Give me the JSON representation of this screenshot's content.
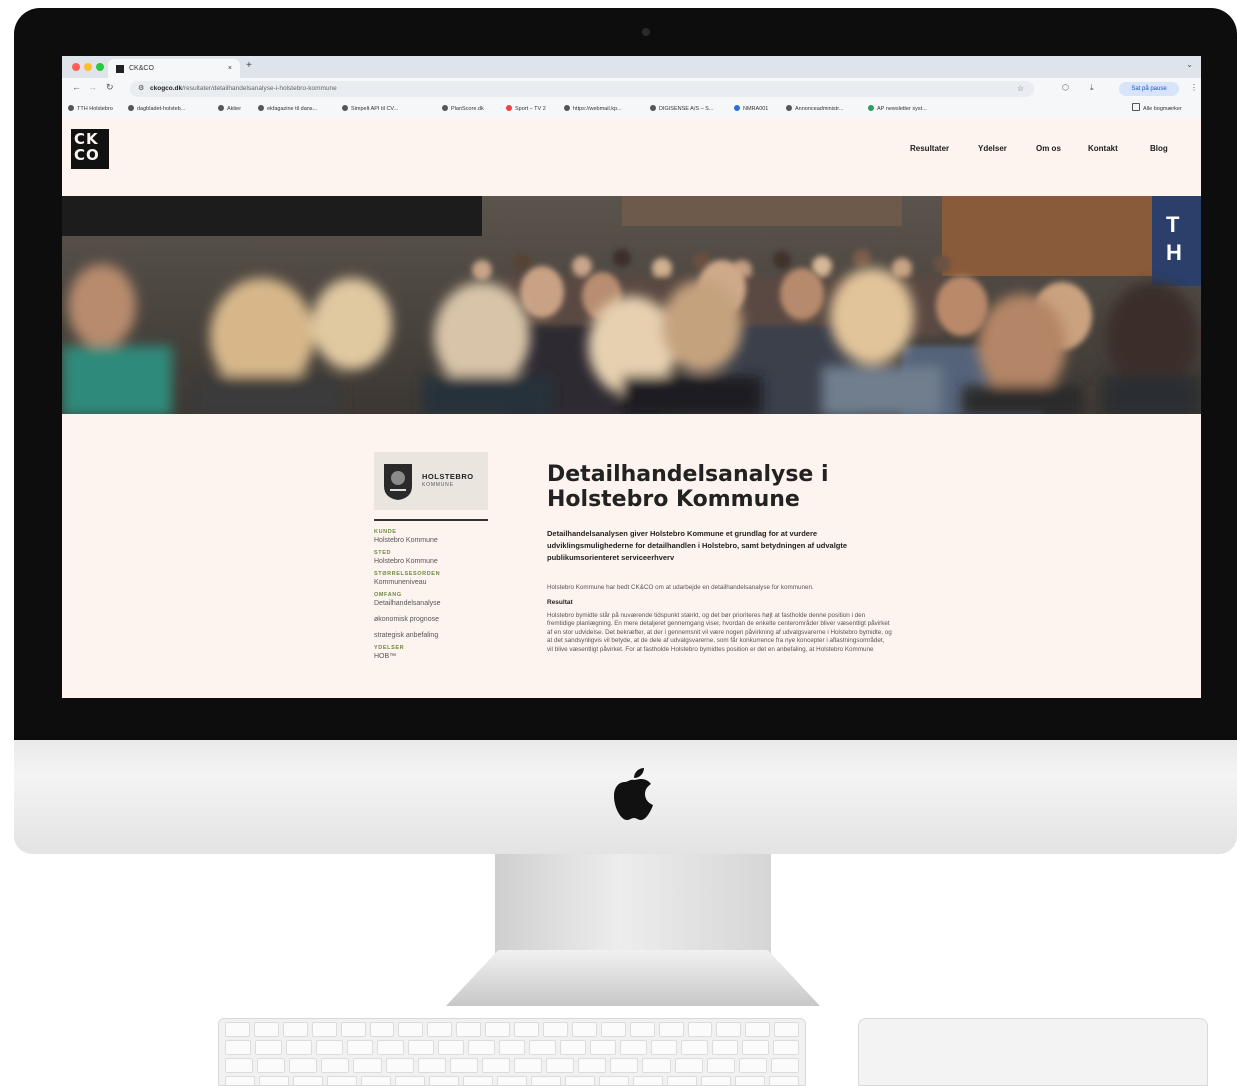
{
  "browser": {
    "tab_title": "CK&CO",
    "tab_close": "×",
    "new_tab": "+",
    "url_domain": "ckogco.dk",
    "url_path": "/resultater/detailhandelsanalyse-i-holstebro-kommune",
    "pause_button": "Sat på pause",
    "bookmarks": [
      "TTH Holstebro",
      "dagbladet-holsteb...",
      "Aktier",
      "ekfagazine til dans...",
      "Simpelt API til CV...",
      "PlanScore.dk",
      "Sport – TV 2",
      "https://webmail.kp...",
      "DIGISENSE A/S – S...",
      "NMRA001",
      "Annonceadministr...",
      "AP newsletter syst..."
    ],
    "bookmarks_all": "Alle bogmærker"
  },
  "site": {
    "logo_text": "CK CO",
    "nav": [
      "Resultater",
      "Ydelser",
      "Om os",
      "Kontakt",
      "Blog"
    ]
  },
  "client_logo": {
    "name": "HOLSTEBRO",
    "sub": "KOMMUNE"
  },
  "meta": {
    "kunde_label": "KUNDE",
    "kunde_value": "Holstebro Kommune",
    "sted_label": "STED",
    "sted_value": "Holstebro Kommune",
    "stoerrelse_label": "STØRRELSESORDEN",
    "stoerrelse_value": "Kommuneniveau",
    "omfang_label": "OMFANG",
    "omfang_values": [
      "Detailhandelsanalyse",
      "økonomisk prognose",
      "strategisk anbefaling"
    ],
    "ydelser_label": "YDELSER",
    "ydelser_value": "HOB™"
  },
  "article": {
    "title": "Detailhandelsanalyse i Holstebro Kommune",
    "lead": "Detailhandelsanalysen giver Holstebro Kommune et grundlag for at vurdere udviklingsmulighederne for detailhandlen i Holstebro, samt betydningen af udvalgte publikumsorienteret serviceerhverv",
    "intro": "Holstebro Kommune har bedt CK&CO om at udarbejde en detailhandelsanalyse for kommunen.",
    "result_heading": "Resultat",
    "result_text": "Holstebro bymidte står på nuværende tidspunkt stærkt, og det bør prioriteres højt at fastholde denne position i den fremtidige planlægning. En mere detaljeret gennemgang viser, hvordan de enkelte centerområder bliver væsentligt påvirket af en stor udvidelse. Det bekræfter, at der i gennemsnit vil være nogen påvirkning af udvalgsvarerne i Holstebro bymidte, og at det sandsynligvis vil betyde, at de dele af udvalgsvarerne, som får konkurrence fra nye koncepter i aflastningsområdet, vil blive væsentligt påvirket. For at fastholde Holstebro bymidtes position er det en anbefaling, at Holstebro Kommune"
  },
  "colors": {
    "page_bg": "#fdf4ef",
    "meta_label": "#6e8a3f",
    "bezel": "#0d0d0d"
  }
}
